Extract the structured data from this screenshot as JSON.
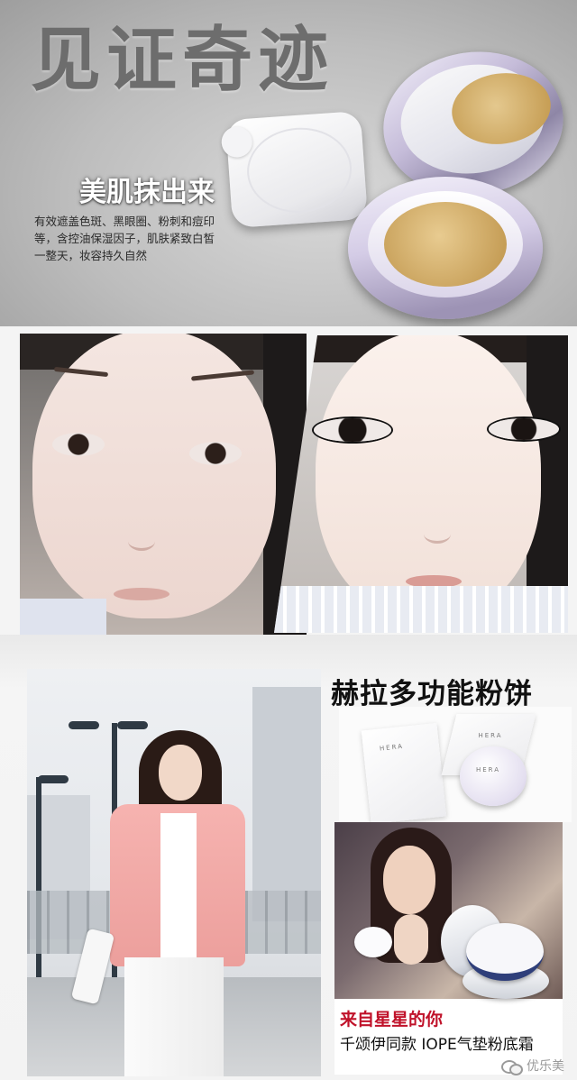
{
  "banner": {
    "headline": "见证奇迹",
    "subhead": "美肌抹出来",
    "description_lines": [
      "有效遮盖色斑、黑眼圈、粉刺和痘印",
      "等，含控油保湿因子，肌肤紧致白皙",
      "一整天，妆容持久自然"
    ]
  },
  "product": {
    "title": "赫拉多功能粉饼",
    "brand_mark": "HERA"
  },
  "star_promo": {
    "caption_line1": "来自星星的你",
    "caption_line2": "千颂伊同款 IOPE气垫粉底霜"
  },
  "watermark": {
    "text": "优乐美",
    "icon": "wechat-icon"
  },
  "colors": {
    "caption_red": "#c0122a",
    "headline_gray": "#6d6d6d",
    "compact_lavender": "#c5bcd9"
  }
}
